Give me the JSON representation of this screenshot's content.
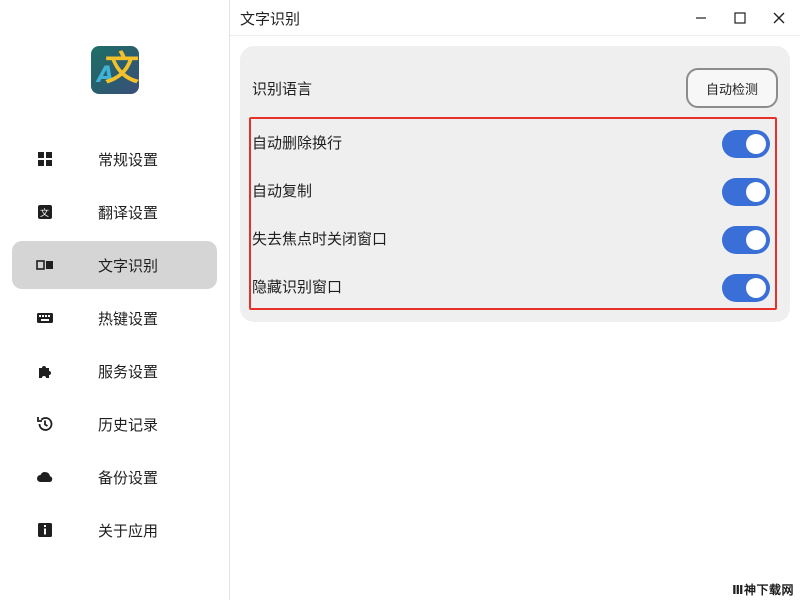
{
  "app": {
    "title": "文字识别",
    "logo_text": "文",
    "logo_sub": "A"
  },
  "window_controls": {
    "minimize_icon": "minimize-icon",
    "maximize_icon": "maximize-icon",
    "close_icon": "close-icon"
  },
  "sidebar": {
    "items": [
      {
        "label": "常规设置",
        "icon": "grid-icon",
        "active": false
      },
      {
        "label": "翻译设置",
        "icon": "translate-icon",
        "active": false
      },
      {
        "label": "文字识别",
        "icon": "ocr-icon",
        "active": true
      },
      {
        "label": "热键设置",
        "icon": "keyboard-icon",
        "active": false
      },
      {
        "label": "服务设置",
        "icon": "puzzle-icon",
        "active": false
      },
      {
        "label": "历史记录",
        "icon": "history-icon",
        "active": false
      },
      {
        "label": "备份设置",
        "icon": "cloud-icon",
        "active": false
      },
      {
        "label": "关于应用",
        "icon": "info-icon",
        "active": false
      }
    ]
  },
  "settings": {
    "language_label": "识别语言",
    "language_value": "自动检测",
    "toggles": [
      {
        "label": "自动删除换行",
        "on": true
      },
      {
        "label": "自动复制",
        "on": true
      },
      {
        "label": "失去焦点时关闭窗口",
        "on": true
      },
      {
        "label": "隐藏识别窗口",
        "on": true
      }
    ]
  },
  "colors": {
    "toggle_on": "#3a6fd8",
    "highlight": "#e5312a",
    "active_nav": "#d5d5d5"
  },
  "watermark": "Ⅲ神下载网"
}
